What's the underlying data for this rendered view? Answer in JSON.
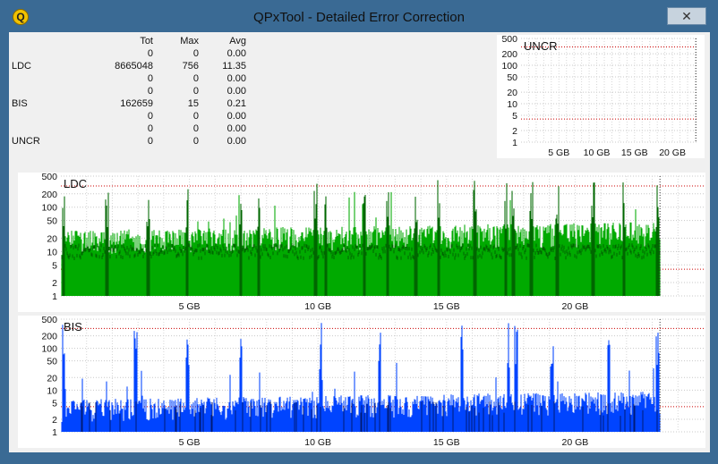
{
  "window": {
    "title": "QPxTool - Detailed Error Correction",
    "close_label": "✕",
    "app_icon_letter": "Q",
    "accent": "#3a6a94"
  },
  "stats": {
    "headers": [
      "",
      "Tot",
      "Max",
      "Avg"
    ],
    "rows": [
      {
        "label": "",
        "tot": "0",
        "max": "0",
        "avg": "0.00"
      },
      {
        "label": "LDC",
        "tot": "8665048",
        "max": "756",
        "avg": "11.35"
      },
      {
        "label": "",
        "tot": "0",
        "max": "0",
        "avg": "0.00"
      },
      {
        "label": "",
        "tot": "0",
        "max": "0",
        "avg": "0.00"
      },
      {
        "label": "BIS",
        "tot": "162659",
        "max": "15",
        "avg": "0.21"
      },
      {
        "label": "",
        "tot": "0",
        "max": "0",
        "avg": "0.00"
      },
      {
        "label": "",
        "tot": "0",
        "max": "0",
        "avg": "0.00"
      },
      {
        "label": "UNCR",
        "tot": "0",
        "max": "0",
        "avg": "0.00"
      }
    ]
  },
  "chart_data": [
    {
      "type": "area",
      "title": "UNCR",
      "yscale": "log",
      "ylim": [
        1,
        500
      ],
      "y_ticks": [
        "500",
        "200",
        "100",
        "50",
        "20",
        "10",
        "5",
        "2",
        "1"
      ],
      "x_ticks": [
        "5 GB",
        "10 GB",
        "15 GB",
        "20 GB"
      ],
      "x_tick_values": [
        5,
        10,
        15,
        20
      ],
      "xlim": [
        0,
        23.3
      ],
      "series": [
        {
          "values": [],
          "color": "#cc0000"
        }
      ],
      "threshold_lines": [
        300,
        4
      ]
    },
    {
      "type": "area",
      "title": "LDC",
      "yscale": "log",
      "ylim": [
        1,
        500
      ],
      "y_ticks": [
        "500",
        "200",
        "100",
        "50",
        "20",
        "10",
        "5",
        "2",
        "1"
      ],
      "x_ticks": [
        "5 GB",
        "10 GB",
        "15 GB",
        "20 GB"
      ],
      "x_tick_values": [
        5,
        10,
        15,
        20
      ],
      "xlim": [
        0,
        25
      ],
      "data_end_gb": 23.3,
      "typical_level": 15,
      "average_level": 10,
      "spikes_gb": [
        0.1,
        1.8,
        3.4,
        4.9,
        7.0,
        7.7,
        9.9,
        10.3,
        11.8,
        12.7,
        13.8,
        14.7,
        16.1,
        17.3,
        17.6,
        18.3,
        19.3,
        20.7,
        21.9,
        23.2
      ],
      "series": [
        {
          "name": "LDC",
          "color": "#00aa00"
        },
        {
          "color": "#006600"
        }
      ],
      "threshold_lines": [
        300,
        4
      ]
    },
    {
      "type": "area",
      "title": "BIS",
      "yscale": "log",
      "ylim": [
        1,
        500
      ],
      "y_ticks": [
        "500",
        "200",
        "100",
        "50",
        "20",
        "10",
        "5",
        "2",
        "1"
      ],
      "x_ticks": [
        "5 GB",
        "10 GB",
        "15 GB",
        "20 GB"
      ],
      "x_tick_values": [
        5,
        10,
        15,
        20
      ],
      "xlim": [
        0,
        25
      ],
      "data_end_gb": 23.3,
      "typical_level": 3,
      "spikes_gb": [
        0.1,
        2.9,
        4.9,
        7.0,
        10.1,
        12.4,
        15.6,
        17.4,
        17.7,
        19.1,
        21.3,
        23.2
      ],
      "series": [
        {
          "name": "BIS",
          "color": "#0044ff"
        },
        {
          "color": "#001b77"
        }
      ],
      "threshold_lines": [
        300,
        4
      ]
    }
  ]
}
